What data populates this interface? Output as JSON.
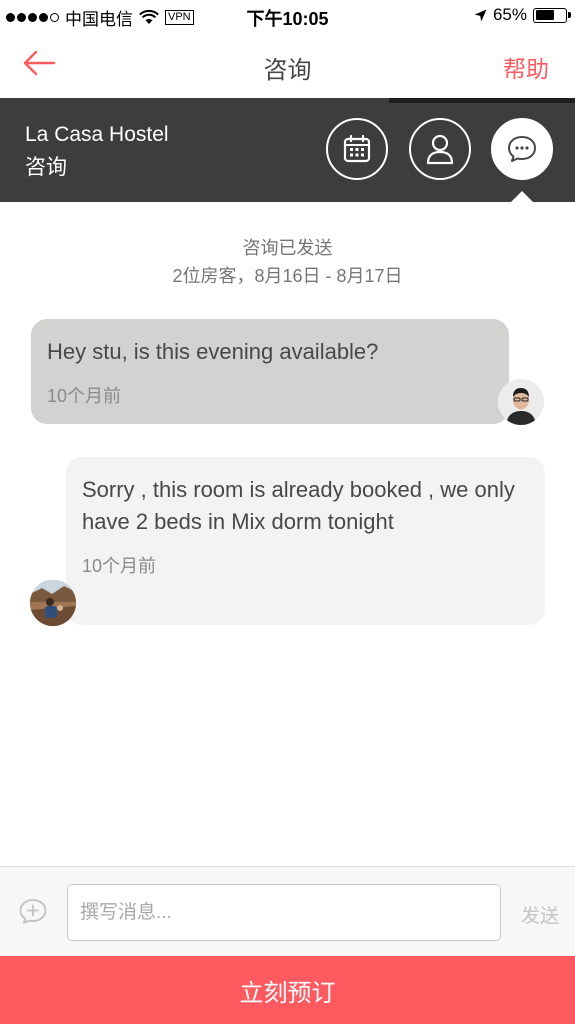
{
  "status_bar": {
    "carrier": "中国电信",
    "vpn": "VPN",
    "time": "下午10:05",
    "battery": "65%",
    "battery_level": 0.65
  },
  "nav": {
    "title": "咨询",
    "help": "帮助",
    "back_icon": "arrow-left-icon"
  },
  "host_header": {
    "name": "La Casa Hostel",
    "subtitle": "咨询",
    "buttons": [
      "calendar-icon",
      "person-icon",
      "chat-icon"
    ]
  },
  "conversation": {
    "sent_label": "咨询已发送",
    "details": "2位房客，8月16日 - 8月17日",
    "messages": [
      {
        "text": "Hey stu, is this evening available?",
        "time": "10个月前"
      },
      {
        "text": "Sorry , this room is already booked , we only have 2 beds in Mix dorm tonight",
        "time": "10个月前"
      }
    ]
  },
  "composer": {
    "placeholder": "撰写消息...",
    "send": "发送",
    "icon": "add-comment-icon"
  },
  "cta": {
    "book": "立刻预订"
  },
  "colors": {
    "accent": "#ff5a5f",
    "header_bg": "#3d3d3d"
  }
}
